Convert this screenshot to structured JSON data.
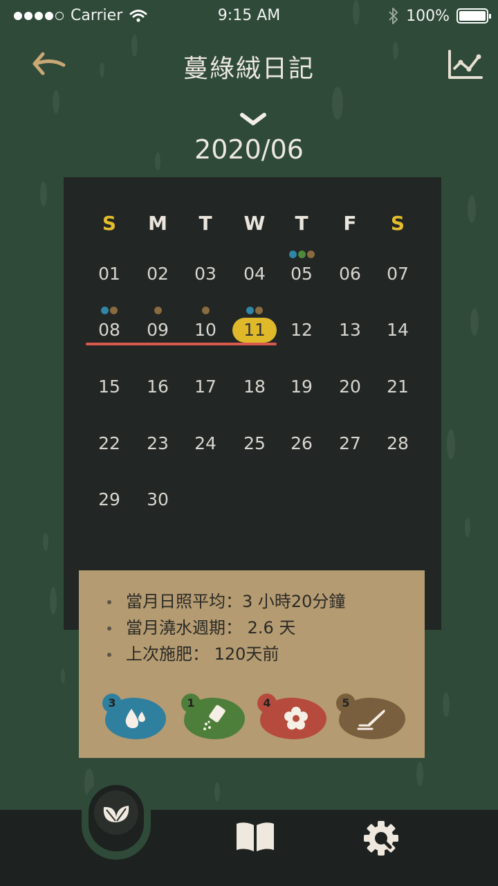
{
  "status_bar": {
    "carrier": "Carrier",
    "time": "9:15 AM",
    "battery": "100%"
  },
  "header": {
    "title": "蔓綠絨日記",
    "back_icon": "back-arrow-icon",
    "chart_icon": "line-chart-icon",
    "month": "2020/06"
  },
  "calendar": {
    "weekdays": [
      "S",
      "M",
      "T",
      "W",
      "T",
      "F",
      "S"
    ],
    "weekend_color": "#e3bd2c",
    "days": [
      "01",
      "02",
      "03",
      "04",
      "05",
      "06",
      "07",
      "08",
      "09",
      "10",
      "11",
      "12",
      "13",
      "14",
      "15",
      "16",
      "17",
      "18",
      "19",
      "20",
      "21",
      "22",
      "23",
      "24",
      "25",
      "26",
      "27",
      "28",
      "29",
      "30"
    ],
    "today": "11",
    "today_color": "#e0b92a",
    "underline_color": "#d9594c",
    "markers": [
      {
        "day": "05",
        "colors": [
          "#2f86a6",
          "#4f8a3a",
          "#8a6a3f"
        ]
      },
      {
        "day": "08",
        "colors": [
          "#2f86a6",
          "#8a6a3f"
        ]
      },
      {
        "day": "09",
        "colors": [
          "#8a6a3f"
        ]
      },
      {
        "day": "10",
        "colors": [
          "#8a6a3f"
        ]
      },
      {
        "day": "11",
        "colors": [
          "#2f86a6",
          "#8a6a3f"
        ]
      }
    ]
  },
  "info": {
    "items": [
      "當月日照平均：3 小時20分鐘",
      "當月澆水週期： 2.6 天",
      "上次施肥： 120天前"
    ]
  },
  "badges": [
    {
      "count": "3",
      "icon": "water-drop-icon",
      "color": "#2f7f9e"
    },
    {
      "count": "1",
      "icon": "fertilizer-icon",
      "color": "#4e7f3a"
    },
    {
      "count": "4",
      "icon": "flower-icon",
      "color": "#b64a3c"
    },
    {
      "count": "5",
      "icon": "pen-note-icon",
      "color": "#7a5f3e"
    }
  ],
  "tabbar": {
    "items": [
      "leaf-icon",
      "book-icon",
      "settings-gear-icon"
    ]
  }
}
